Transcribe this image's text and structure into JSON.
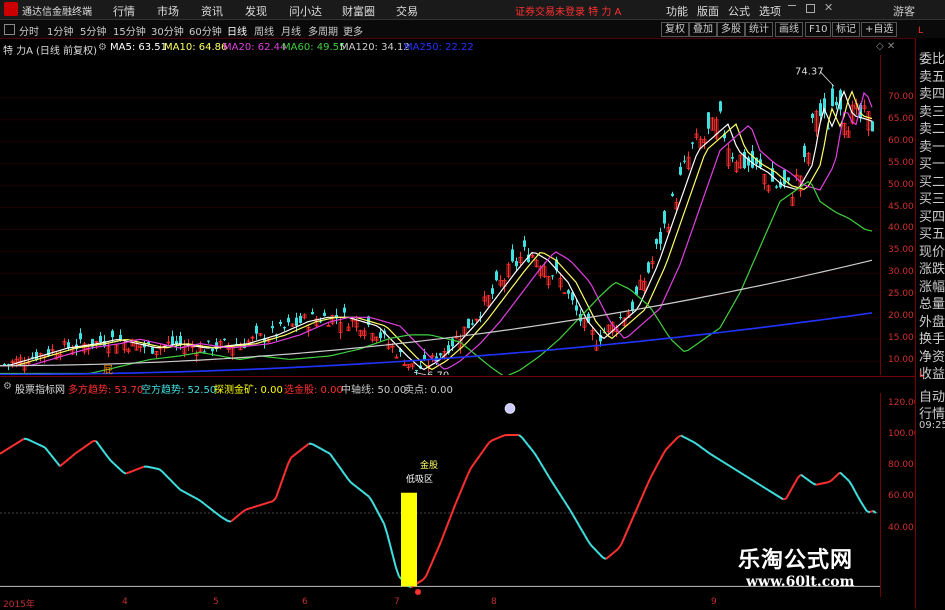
{
  "app": {
    "title": "通达信金融终端",
    "window_badge": "游客"
  },
  "menu": {
    "items": [
      "行情",
      "市场",
      "资讯",
      "发现",
      "问小达",
      "财富圈",
      "交易"
    ],
    "alert": "证券交易未登录 特 力 A",
    "right_items": [
      "功能",
      "版面",
      "公式",
      "选项"
    ]
  },
  "toolbar": {
    "periods": [
      "分时",
      "1分钟",
      "5分钟",
      "15分钟",
      "30分钟",
      "60分钟",
      "日线",
      "周线",
      "月线",
      "多周期",
      "更多"
    ],
    "active_period": "日线",
    "buttons": [
      "复权",
      "叠加",
      "多股",
      "统计",
      "画线",
      "F10",
      "标记",
      "+自选"
    ]
  },
  "stock": {
    "name": "特 力A",
    "adj": "(日线 前复权)"
  },
  "ma": [
    {
      "label": "MA5: 63.51",
      "color": "#ffffff"
    },
    {
      "label": "MA10: 64.86",
      "color": "#ffff66"
    },
    {
      "label": "MA20: 62.44",
      "color": "#e040e0"
    },
    {
      "label": "MA60: 49.55",
      "color": "#40d040"
    },
    {
      "label": "MA120: 34.12",
      "color": "#cccccc"
    },
    {
      "label": "MA250: 22.22",
      "color": "#2233ff"
    }
  ],
  "price_axis": [
    "70.00",
    "65.00",
    "60.00",
    "55.00",
    "50.00",
    "45.00",
    "40.00",
    "35.00",
    "30.00",
    "25.00",
    "20.00",
    "15.00",
    "10.00"
  ],
  "annotations": {
    "high": "74.37",
    "low": "6.70",
    "fill_label": "屁"
  },
  "right_panel": {
    "top": "L",
    "items": [
      "委比",
      "卖五",
      "卖四",
      "卖三",
      "卖二",
      "卖一",
      "买一",
      "买二",
      "买三",
      "买四",
      "买五",
      "现价",
      "涨跌",
      "涨幅",
      "总量",
      "外盘",
      "换手",
      "净资",
      "收益"
    ],
    "bottom": "L",
    "bottom_items": [
      "自动",
      "行情",
      "09:25"
    ]
  },
  "indicator": {
    "name": "股票指标网",
    "fields": [
      {
        "label": "多方趋势: 53.70",
        "color": "#ff3030"
      },
      {
        "label": "空方趋势: 52.50",
        "color": "#40e0e0"
      },
      {
        "label": "探测金矿: 0.00",
        "color": "#ffff00"
      },
      {
        "label": "选金股: 0.00",
        "color": "#ff3030"
      },
      {
        "label": "中轴线: 50.00",
        "color": "#cccccc"
      },
      {
        "label": "卖点: 0.00",
        "color": "#cccccc"
      }
    ],
    "axis": [
      "120.00",
      "100.00",
      "80.00",
      "60.00",
      "40.00"
    ],
    "signal_labels": [
      "金股",
      "低吸区"
    ]
  },
  "x_axis": [
    "2015年",
    "4",
    "5",
    "6",
    "7",
    "8",
    "9"
  ],
  "watermark": {
    "cn": "乐淘公式网",
    "url": "www.60lt.com"
  }
}
